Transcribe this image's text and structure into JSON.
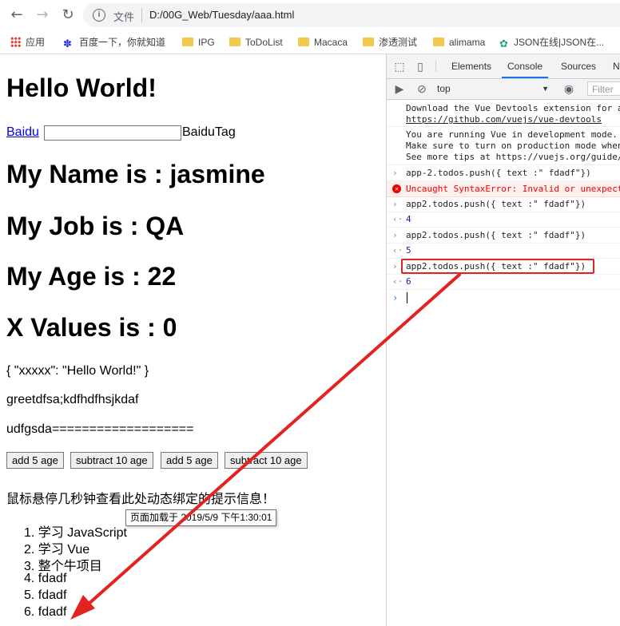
{
  "browser": {
    "nav": {
      "back": "←",
      "forward": "→",
      "reload": "↻"
    },
    "address": {
      "scheme_label": "文件",
      "url": "D:/00G_Web/Tuesday/aaa.html"
    },
    "bookmarks": [
      {
        "label": "应用",
        "icon": "apps-grid-icon"
      },
      {
        "label": "百度一下，你就知道",
        "icon": "baidu-paw-icon"
      },
      {
        "label": "IPG",
        "icon": "folder-icon"
      },
      {
        "label": "ToDoList",
        "icon": "folder-icon"
      },
      {
        "label": "Macaca",
        "icon": "folder-icon"
      },
      {
        "label": "渗透测试",
        "icon": "folder-icon"
      },
      {
        "label": "alimama",
        "icon": "folder-icon"
      },
      {
        "label": "JSON在线|JSON在...",
        "icon": "json-gear-icon"
      }
    ]
  },
  "page": {
    "heading": "Hello World!",
    "link_text": "Baidu",
    "input_value": "",
    "tag_text": "BaiduTag",
    "name_line": "My Name is : jasmine",
    "job_line": "My Job is : QA",
    "age_line": "My Age is : 22",
    "x_line": "X Values is : 0",
    "json_text": "{ \"xxxxx\": \"Hello World!\" }",
    "greet_text": "greetdfsa;kdfhdfhsjkdaf",
    "udf_text": "udfgsda===================",
    "buttons": [
      "add 5 age",
      "subtract 10 age",
      "add 5 age",
      "subtract 10 age"
    ],
    "hover_text": "鼠标悬停几秒钟查看此处动态绑定的提示信息！",
    "tooltip": "页面加载于 2019/5/9 下午1:30:01",
    "todos": [
      "学习 JavaScript",
      "学习 Vue",
      "整个牛项目",
      "fdadf",
      "fdadf",
      "fdadf"
    ]
  },
  "devtools": {
    "tabs": [
      "Elements",
      "Console",
      "Sources",
      "N"
    ],
    "active_tab": "Console",
    "context": "top",
    "filter_placeholder": "Filter",
    "console": [
      {
        "kind": "info",
        "lines": [
          "Download the Vue Devtools extension for a",
          "https://github.com/vuejs/vue-devtools"
        ]
      },
      {
        "kind": "info",
        "lines": [
          "You are running Vue in development mode.",
          "Make sure to turn on production mode when",
          "See more tips at https://vuejs.org/guide/"
        ]
      },
      {
        "kind": "input",
        "text": "app-2.todos.push({ text :\" fdadf\"})"
      },
      {
        "kind": "error",
        "text": "Uncaught SyntaxError: Invalid or unexpecte"
      },
      {
        "kind": "input",
        "text": "app2.todos.push({ text :\" fdadf\"})"
      },
      {
        "kind": "result",
        "text": "4"
      },
      {
        "kind": "input",
        "text": "app2.todos.push({ text :\" fdadf\"})"
      },
      {
        "kind": "result",
        "text": "5"
      },
      {
        "kind": "input",
        "text": "app2.todos.push({ text :\" fdadf\"})"
      },
      {
        "kind": "result",
        "text": "6"
      }
    ]
  },
  "annotation": {
    "color": "#e32222"
  },
  "colors": {
    "link": "#0000ee",
    "active_tab_underline": "#1a73e8",
    "error_text": "#ee0000",
    "result_number": "#1a1aa6"
  }
}
